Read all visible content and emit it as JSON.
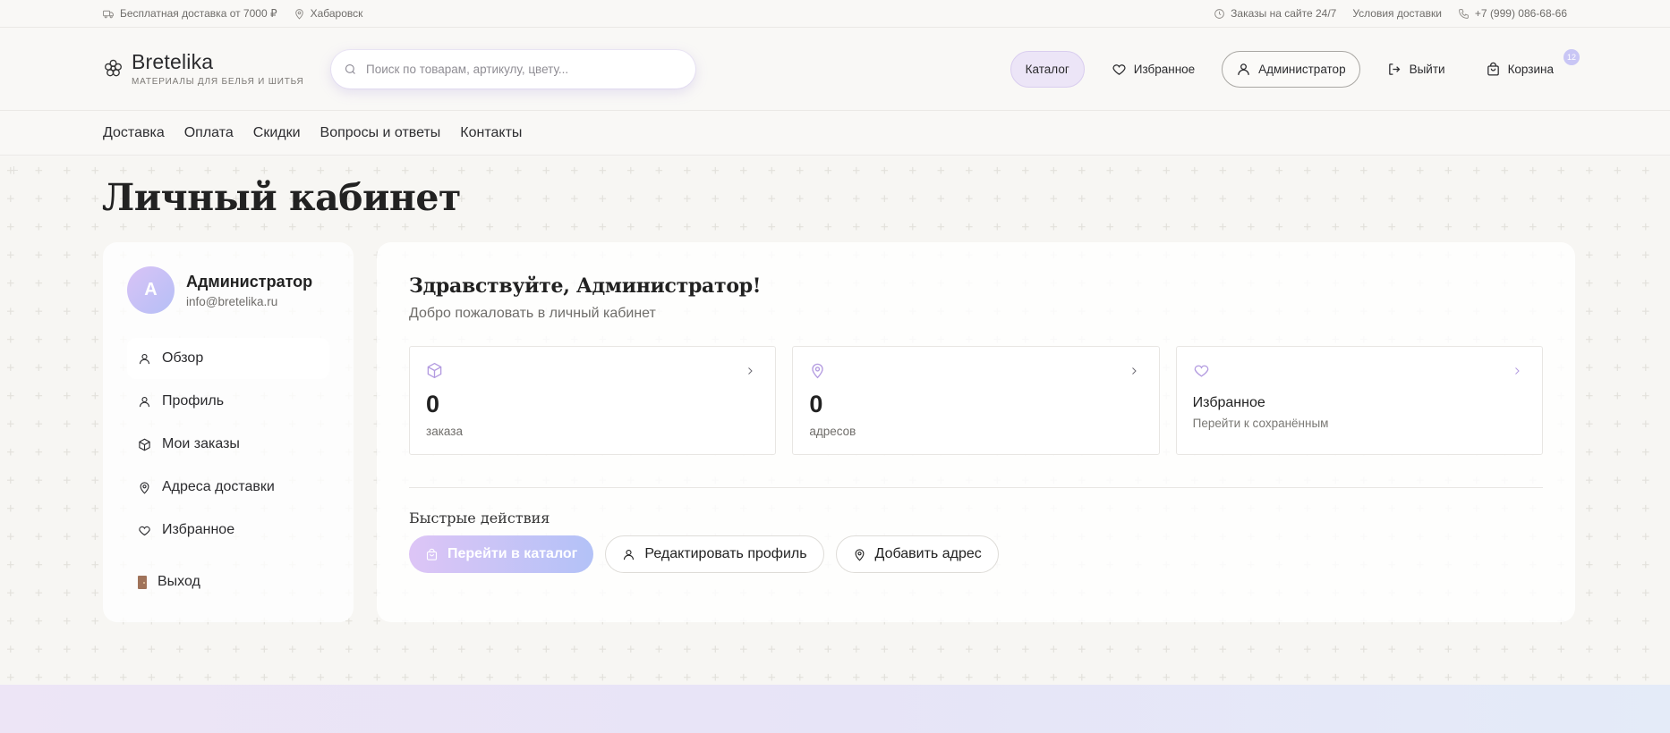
{
  "topbar": {
    "free_delivery": "Бесплатная доставка от 7000 ₽",
    "city": "Хабаровск",
    "orders_24_7": "Заказы на сайте 24/7",
    "delivery_terms": "Условия доставки",
    "phone": "+7 (999) 086-68-66"
  },
  "header": {
    "logo_name": "Bretelika",
    "logo_tagline": "МАТЕРИАЛЫ ДЛЯ БЕЛЬЯ И ШИТЬЯ",
    "search_placeholder": "Поиск по товарам, артикулу, цвету...",
    "catalog": "Каталог",
    "favorites": "Избранное",
    "account": "Администратор",
    "logout": "Выйти",
    "cart": "Корзина",
    "cart_count": "12"
  },
  "nav": {
    "items": [
      "Доставка",
      "Оплата",
      "Скидки",
      "Вопросы и ответы",
      "Контакты"
    ]
  },
  "page": {
    "title": "Личный кабинет"
  },
  "sidebar": {
    "avatar_letter": "А",
    "user_name": "Администратор",
    "user_email": "info@bretelika.ru",
    "items": [
      {
        "label": "Обзор",
        "icon": "user-icon"
      },
      {
        "label": "Профиль",
        "icon": "user-icon"
      },
      {
        "label": "Мои заказы",
        "icon": "box-icon"
      },
      {
        "label": "Адреса доставки",
        "icon": "map-pin-icon"
      },
      {
        "label": "Избранное",
        "icon": "heart-icon"
      }
    ],
    "logout": "Выход"
  },
  "dashboard": {
    "greeting": "Здравствуйте, Администратор!",
    "subtitle": "Добро пожаловать в личный кабинет",
    "orders_count": "0",
    "orders_label": "заказа",
    "addresses_count": "0",
    "addresses_label": "адресов",
    "favorites_title": "Избранное",
    "favorites_desc": "Перейти к сохранённым",
    "quick_actions_title": "Быстрые действия",
    "action_catalog": "Перейти в каталог",
    "action_edit_profile": "Редактировать профиль",
    "action_add_address": "Добавить адрес"
  },
  "colors": {
    "accent_lavender": "#b39be0",
    "gradient_start": "#ddc5f6",
    "gradient_end": "#b3c2f7",
    "background": "#f7f6f3"
  }
}
